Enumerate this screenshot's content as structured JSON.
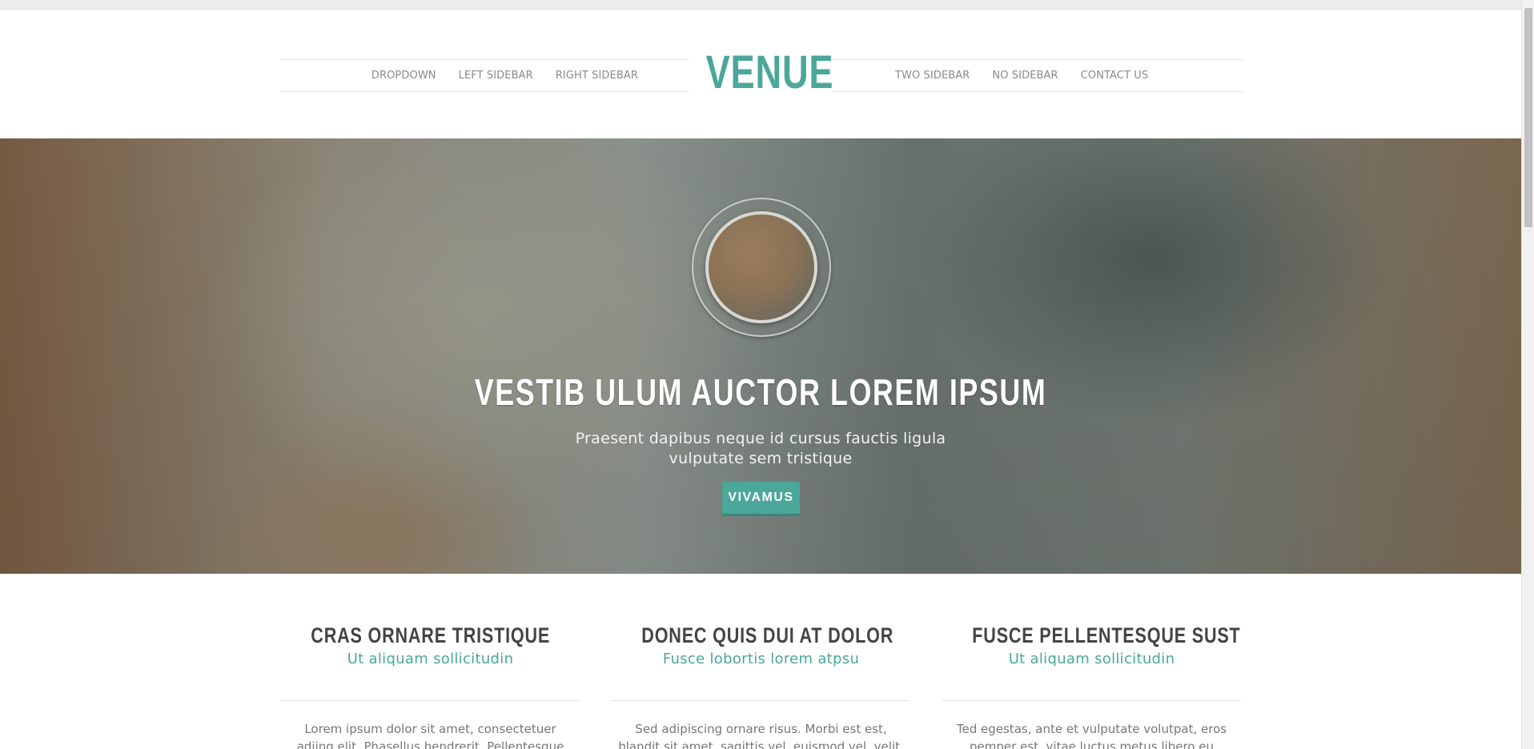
{
  "header": {
    "logo": "VENUE",
    "nav_left": [
      "DROPDOWN",
      "LEFT SIDEBAR",
      "RIGHT SIDEBAR"
    ],
    "nav_right": [
      "TWO SIDEBAR",
      "NO SIDEBAR",
      "CONTACT US"
    ]
  },
  "hero": {
    "title": "VESTIB ULUM AUCTOR LOREM IPSUM",
    "subtitle": "Praesent dapibus neque id cursus fauctis ligula vulputate sem tristique",
    "button_label": "VIVAMUS"
  },
  "features": [
    {
      "title": "CRAS ORNARE TRISTIQUE",
      "subtitle": "Ut aliquam sollicitudin",
      "text": "Lorem ipsum dolor sit amet, consectetuer adiing elit. Phasellus hendrerit. Pellentesque aliquet nibb"
    },
    {
      "title": "DONEC QUIS DUI AT DOLOR",
      "subtitle": "Fusce lobortis lorem atpsu",
      "text": "Sed adipiscing ornare risus. Morbi est est, blandit sit amet, sagittis vel, euismod vel, velit."
    },
    {
      "title": "FUSCE PELLENTESQUE SUST",
      "subtitle": "Ut aliquam sollicitudin",
      "text": "Ted egestas, ante et vulputate volutpat, eros pemper est, vitae luctus metus libero eu augue."
    }
  ],
  "colors": {
    "accent": "#4aa79a",
    "heading": "#444444",
    "body_text": "#777777",
    "nav_text": "#8a8a8a"
  }
}
